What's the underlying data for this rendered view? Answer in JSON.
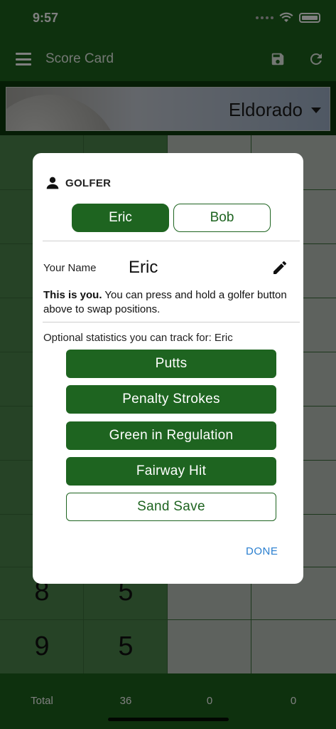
{
  "status_bar": {
    "time": "9:57"
  },
  "app_bar": {
    "title": "Score Card"
  },
  "course": {
    "name": "Eldorado"
  },
  "scores": [
    {
      "hole": "8",
      "strokes": "5"
    },
    {
      "hole": "9",
      "strokes": "5"
    }
  ],
  "totals": {
    "label": "Total",
    "p1": "36",
    "p2": "0",
    "p3": "0"
  },
  "dialog": {
    "heading": "GOLFER",
    "golfers": [
      {
        "label": "Eric",
        "selected": true
      },
      {
        "label": "Bob",
        "selected": false
      }
    ],
    "name_label": "Your Name",
    "name_value": "Eric",
    "info_bold": "This is you.",
    "info_rest": " You can press and hold a golfer button above to swap positions.",
    "optional_text": "Optional statistics you can track for: Eric",
    "stats": [
      {
        "label": "Putts",
        "enabled": true
      },
      {
        "label": "Penalty Strokes",
        "enabled": true
      },
      {
        "label": "Green in Regulation",
        "enabled": true
      },
      {
        "label": "Fairway Hit",
        "enabled": true
      },
      {
        "label": "Sand Save",
        "enabled": false
      }
    ],
    "done_label": "DONE"
  },
  "colors": {
    "primary": "#1e6420",
    "accent_link": "#2a7fd0"
  }
}
